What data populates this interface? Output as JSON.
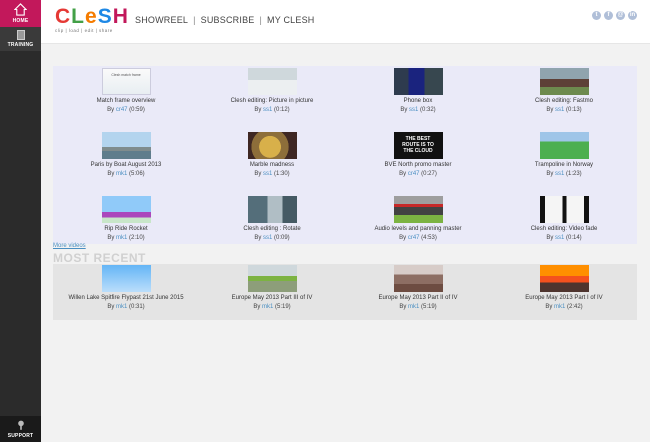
{
  "sidebar": {
    "home_label": "HOME",
    "training_label": "TRAINING",
    "support_label": "SUPPORT"
  },
  "header": {
    "logo_text": "CLeSH",
    "logo_tagline": "clip | load | edit | share",
    "nav": [
      "SHOWREEL",
      "SUBSCRIBE",
      "MY CLESH"
    ],
    "social": [
      "twitter-icon",
      "facebook-icon",
      "email-icon",
      "linkedin-icon"
    ]
  },
  "featured": [
    {
      "title": "Match frame overview",
      "by": "By",
      "user": "cr47",
      "duration": "(0:59)",
      "thumb": "slide"
    },
    {
      "title": "Clesh editing: Picture in picture",
      "by": "By",
      "user": "ss1",
      "duration": "(0:12)",
      "thumb": "snow"
    },
    {
      "title": "Phone box",
      "by": "By",
      "user": "ss1",
      "duration": "(0:32)",
      "thumb": "phone"
    },
    {
      "title": "Clesh editing: Fastmo",
      "by": "By",
      "user": "ss1",
      "duration": "(0:13)",
      "thumb": "street"
    },
    {
      "title": "Paris by Boat August 2013",
      "by": "By",
      "user": "mk1",
      "duration": "(5:06)",
      "thumb": "paris"
    },
    {
      "title": "Marble madness",
      "by": "By",
      "user": "ss1",
      "duration": "(1:30)",
      "thumb": "marble"
    },
    {
      "title": "BVE North promo master",
      "by": "By",
      "user": "cr47",
      "duration": "(0:27)",
      "thumb": "cloud"
    },
    {
      "title": "Trampoline in Norway",
      "by": "By",
      "user": "ss1",
      "duration": "(1:23)",
      "thumb": "tramp"
    },
    {
      "title": "Rip Ride Rocket",
      "by": "By",
      "user": "mk1",
      "duration": "(2:10)",
      "thumb": "rocket"
    },
    {
      "title": "Clesh editing : Rotate",
      "by": "By",
      "user": "ss1",
      "duration": "(0:09)",
      "thumb": "rotate"
    },
    {
      "title": "Audio levels and panning master",
      "by": "By",
      "user": "cr47",
      "duration": "(4:53)",
      "thumb": "audio"
    },
    {
      "title": "Clesh editing: Video fade",
      "by": "By",
      "user": "ss1",
      "duration": "(0:14)",
      "thumb": "fade"
    }
  ],
  "thumb_cloud_text": "THE BEST ROUTE IS TO THE CLOUD",
  "thumb_slide_text": "Clesh match frame",
  "more_videos": "More videos",
  "recent_title": "MOST RECENT",
  "recent": [
    {
      "title": "Willen Lake Spitfire Flypast 21st June 2015",
      "by": "By",
      "user": "mk1",
      "duration": "(0:31)",
      "thumb": "sky"
    },
    {
      "title": "Europe May 2013 Part III of IV",
      "by": "By",
      "user": "mk1",
      "duration": "(5:19)",
      "thumb": "river"
    },
    {
      "title": "Europe May 2013 Part II of IV",
      "by": "By",
      "user": "mk1",
      "duration": "(5:19)",
      "thumb": "village"
    },
    {
      "title": "Europe May 2013 Part I of IV",
      "by": "By",
      "user": "mk1",
      "duration": "(2:42)",
      "thumb": "sunset"
    }
  ]
}
